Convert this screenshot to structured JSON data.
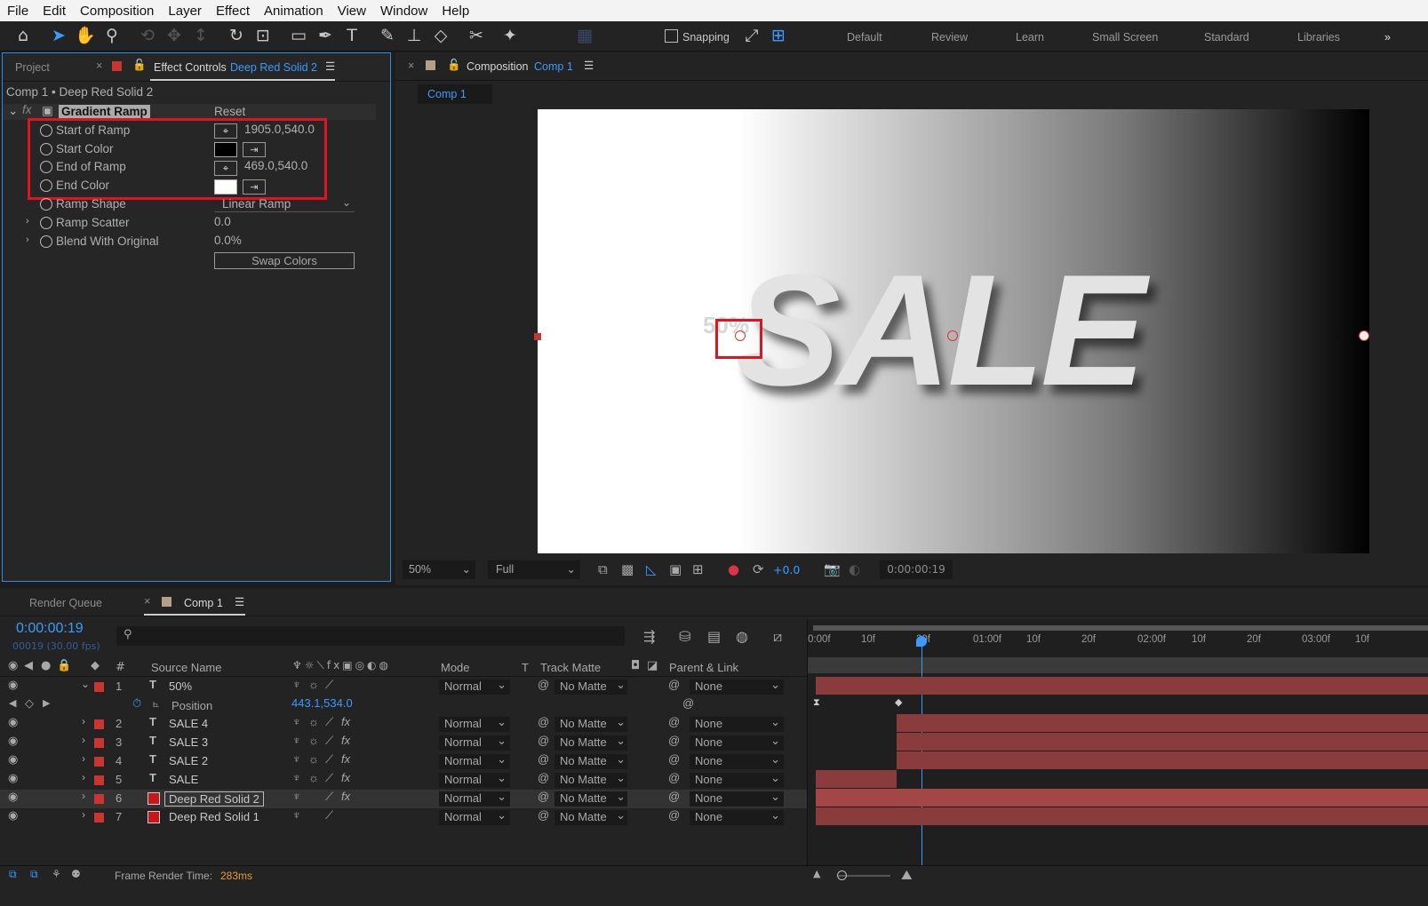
{
  "menu": [
    "File",
    "Edit",
    "Composition",
    "Layer",
    "Effect",
    "Animation",
    "View",
    "Window",
    "Help"
  ],
  "toolbar": {
    "snapping": "Snapping",
    "workspaces": [
      "Default",
      "Review",
      "Learn",
      "Small Screen",
      "Standard",
      "Libraries"
    ]
  },
  "effect_panel": {
    "project_tab": "Project",
    "tab_label": "Effect Controls",
    "layer_name": "Deep Red Solid 2",
    "breadcrumb": "Comp 1 • Deep Red Solid 2",
    "effect_name": "Gradient Ramp",
    "reset": "Reset",
    "props": [
      {
        "label": "Start of Ramp",
        "value": "1905.0,540.0"
      },
      {
        "label": "Start Color",
        "value": ""
      },
      {
        "label": "End of Ramp",
        "value": "469.0,540.0"
      },
      {
        "label": "End Color",
        "value": ""
      },
      {
        "label": "Ramp Shape",
        "value": "Linear Ramp"
      },
      {
        "label": "Ramp Scatter",
        "value": "0.0"
      },
      {
        "label": "Blend With Original",
        "value": "0.0%"
      }
    ],
    "swap": "Swap Colors"
  },
  "comp_panel": {
    "tab_label": "Composition",
    "comp_name": "Comp 1",
    "subtab": "Comp 1",
    "art_text": "SALE",
    "ghost_text": "50%",
    "zoom": "50%",
    "quality": "Full",
    "exposure": "+0.0",
    "timecode": "0:00:00:19"
  },
  "timeline": {
    "render_queue": "Render Queue",
    "comp_tab": "Comp 1",
    "timecode": "0:00:00:19",
    "fps": "00019 (30.00 fps)",
    "headers": {
      "source": "Source Name",
      "mode": "Mode",
      "t": "T",
      "track": "Track Matte",
      "parent": "Parent & Link"
    },
    "ruler": [
      "0:00f",
      "10f",
      "20f",
      "01:00f",
      "10f",
      "20f",
      "02:00f",
      "10f",
      "20f",
      "03:00f",
      "10f"
    ],
    "layers": [
      {
        "n": "1",
        "name": "50%",
        "type": "T",
        "mode": "Normal",
        "matte": "No Matte",
        "parent": "None"
      },
      {
        "n": "2",
        "name": "SALE 4",
        "type": "T",
        "mode": "Normal",
        "matte": "No Matte",
        "parent": "None"
      },
      {
        "n": "3",
        "name": "SALE 3",
        "type": "T",
        "mode": "Normal",
        "matte": "No Matte",
        "parent": "None"
      },
      {
        "n": "4",
        "name": "SALE 2",
        "type": "T",
        "mode": "Normal",
        "matte": "No Matte",
        "parent": "None"
      },
      {
        "n": "5",
        "name": "SALE",
        "type": "T",
        "mode": "Normal",
        "matte": "No Matte",
        "parent": "None"
      },
      {
        "n": "6",
        "name": "Deep Red Solid 2",
        "type": "solid",
        "mode": "Normal",
        "matte": "No Matte",
        "parent": "None"
      },
      {
        "n": "7",
        "name": "Deep Red Solid 1",
        "type": "solid",
        "mode": "Normal",
        "matte": "No Matte",
        "parent": "None"
      }
    ],
    "position": {
      "label": "Position",
      "value": "443.1,534.0"
    },
    "footer": {
      "label": "Frame Render Time:",
      "value": "283ms"
    }
  },
  "colors": {
    "accent": "#2d8ceb",
    "highlight": "#e0141e",
    "layer_red": "#8a3b3b"
  }
}
